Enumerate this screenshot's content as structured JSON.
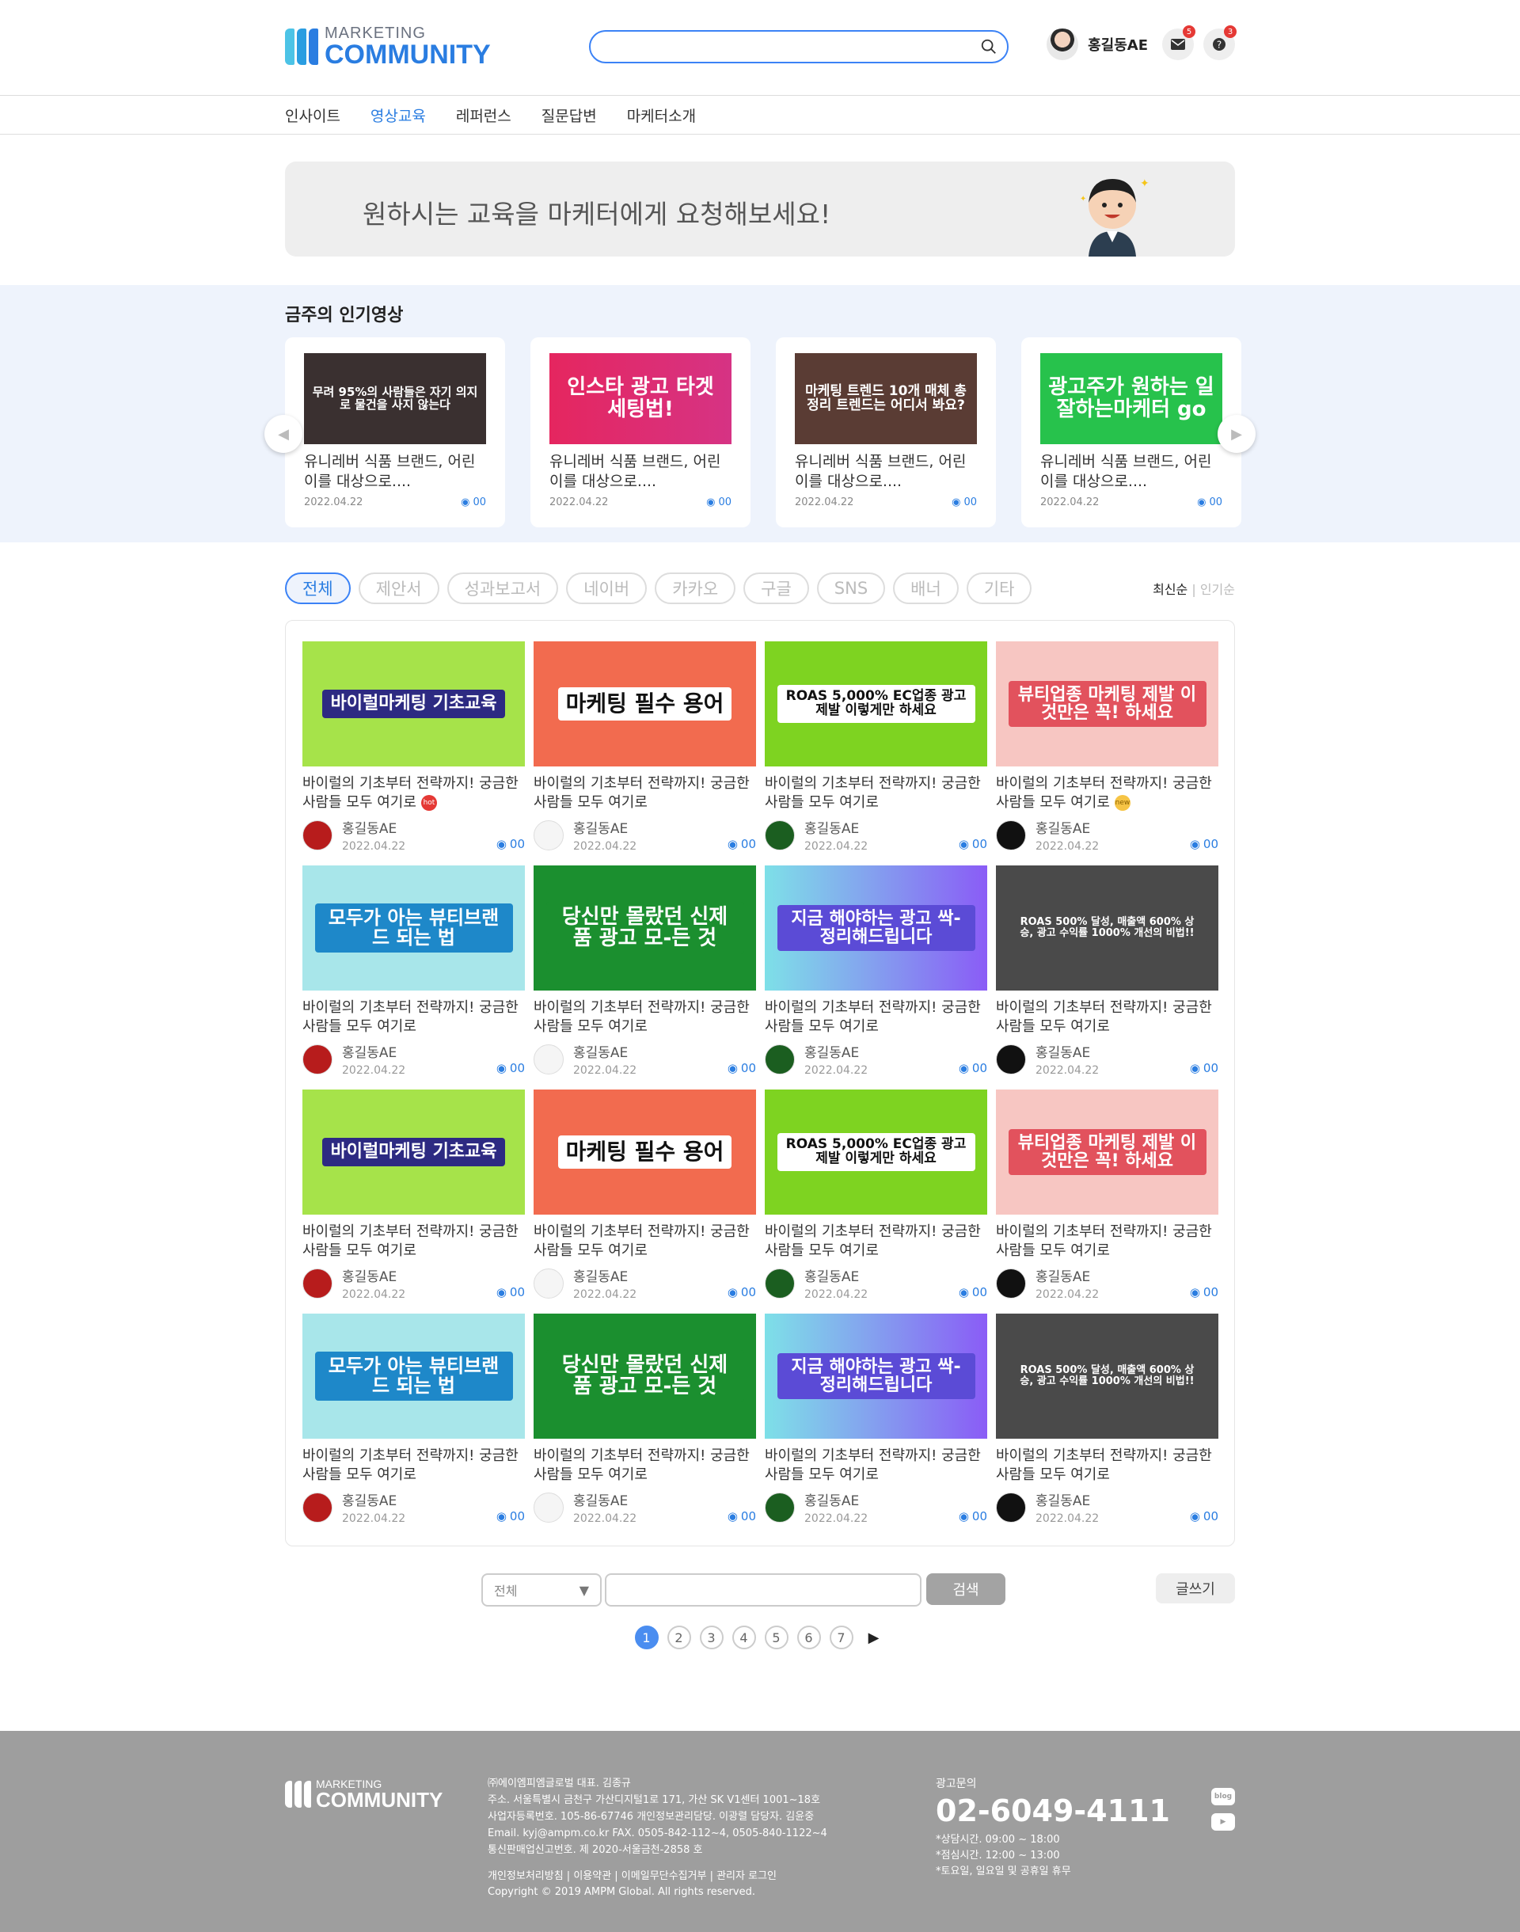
{
  "header": {
    "logo_top": "MARKETING",
    "logo_bottom": "COMMUNITY",
    "search_placeholder": "",
    "user_name": "홍길동AE",
    "mail_badge": "5",
    "question_badge": "3"
  },
  "nav": {
    "items": [
      "인사이트",
      "영상교육",
      "레퍼런스",
      "질문답변",
      "마케터소개"
    ],
    "active": "영상교육"
  },
  "banner": {
    "text": "원하시는 교육을 마케터에게 요청해보세요!"
  },
  "popular": {
    "title": "금주의 인기영상",
    "cards": [
      {
        "thumb": "무려 95%의 사람들은 자기 의지로 물건을 사지 않는다",
        "title": "유니레버 식품 브랜드, 어린이를 대상으로....",
        "date": "2022.04.22",
        "views": "00"
      },
      {
        "thumb": "인스타 광고 타겟 세팅법!",
        "title": "유니레버 식품 브랜드, 어린이를 대상으로....",
        "date": "2022.04.22",
        "views": "00"
      },
      {
        "thumb": "마케팅 트렌드 10개 매체 총정리 트렌드는 어디서 봐요?",
        "title": "유니레버 식품 브랜드, 어린이를 대상으로....",
        "date": "2022.04.22",
        "views": "00"
      },
      {
        "thumb": "광고주가 원하는 일잘하는마케터 go",
        "title": "유니레버 식품 브랜드, 어린이를 대상으로....",
        "date": "2022.04.22",
        "views": "00"
      }
    ]
  },
  "filters": {
    "chips": [
      "전체",
      "제안서",
      "성과보고서",
      "네이버",
      "카카오",
      "구글",
      "SNS",
      "배너",
      "기타"
    ],
    "active": "전체",
    "sort_latest": "최신순",
    "sort_popular": "인기순"
  },
  "videos": [
    {
      "thumb": "바이럴마케팅 기초교육",
      "title": "바이럴의 기초부터 전략까지! 궁금한 사람들 모두 여기로",
      "tag": "hot",
      "author": "홍길동AE",
      "date": "2022.04.22",
      "views": "00"
    },
    {
      "thumb": "마케팅 필수 용어",
      "title": "바이럴의 기초부터 전략까지! 궁금한 사람들 모두 여기로",
      "tag": "",
      "author": "홍길동AE",
      "date": "2022.04.22",
      "views": "00"
    },
    {
      "thumb": "ROAS 5,000% EC업종 광고 제발 이렇게만 하세요",
      "title": "바이럴의 기초부터 전략까지! 궁금한 사람들 모두 여기로",
      "tag": "",
      "author": "홍길동AE",
      "date": "2022.04.22",
      "views": "00"
    },
    {
      "thumb": "뷰티업종 마케팅 제발 이것만은 꼭! 하세요",
      "title": "바이럴의 기초부터 전략까지! 궁금한 사람들 모두 여기로",
      "tag": "new",
      "author": "홍길동AE",
      "date": "2022.04.22",
      "views": "00"
    },
    {
      "thumb": "모두가 아는 뷰티브랜드 되는 법",
      "title": "바이럴의 기초부터 전략까지! 궁금한 사람들 모두 여기로",
      "tag": "",
      "author": "홍길동AE",
      "date": "2022.04.22",
      "views": "00"
    },
    {
      "thumb": "당신만 몰랐던 신제품 광고 모-든 것",
      "title": "바이럴의 기초부터 전략까지! 궁금한 사람들 모두 여기로",
      "tag": "",
      "author": "홍길동AE",
      "date": "2022.04.22",
      "views": "00"
    },
    {
      "thumb": "지금 해야하는 광고 싹-정리해드립니다",
      "title": "바이럴의 기초부터 전략까지! 궁금한 사람들 모두 여기로",
      "tag": "",
      "author": "홍길동AE",
      "date": "2022.04.22",
      "views": "00"
    },
    {
      "thumb": "ROAS 500% 달성, 매출액 600% 상승, 광고 수익률 1000% 개선의 비법!!",
      "title": "바이럴의 기초부터 전략까지! 궁금한 사람들 모두 여기로",
      "tag": "",
      "author": "홍길동AE",
      "date": "2022.04.22",
      "views": "00"
    },
    {
      "thumb": "바이럴마케팅 기초교육",
      "title": "바이럴의 기초부터 전략까지! 궁금한 사람들 모두 여기로",
      "tag": "",
      "author": "홍길동AE",
      "date": "2022.04.22",
      "views": "00"
    },
    {
      "thumb": "마케팅 필수 용어",
      "title": "바이럴의 기초부터 전략까지! 궁금한 사람들 모두 여기로",
      "tag": "",
      "author": "홍길동AE",
      "date": "2022.04.22",
      "views": "00"
    },
    {
      "thumb": "ROAS 5,000% EC업종 광고 제발 이렇게만 하세요",
      "title": "바이럴의 기초부터 전략까지! 궁금한 사람들 모두 여기로",
      "tag": "",
      "author": "홍길동AE",
      "date": "2022.04.22",
      "views": "00"
    },
    {
      "thumb": "뷰티업종 마케팅 제발 이것만은 꼭! 하세요",
      "title": "바이럴의 기초부터 전략까지! 궁금한 사람들 모두 여기로",
      "tag": "",
      "author": "홍길동AE",
      "date": "2022.04.22",
      "views": "00"
    },
    {
      "thumb": "모두가 아는 뷰티브랜드 되는 법",
      "title": "바이럴의 기초부터 전략까지! 궁금한 사람들 모두 여기로",
      "tag": "",
      "author": "홍길동AE",
      "date": "2022.04.22",
      "views": "00"
    },
    {
      "thumb": "당신만 몰랐던 신제품 광고 모-든 것",
      "title": "바이럴의 기초부터 전략까지! 궁금한 사람들 모두 여기로",
      "tag": "",
      "author": "홍길동AE",
      "date": "2022.04.22",
      "views": "00"
    },
    {
      "thumb": "지금 해야하는 광고 싹-정리해드립니다",
      "title": "바이럴의 기초부터 전략까지! 궁금한 사람들 모두 여기로",
      "tag": "",
      "author": "홍길동AE",
      "date": "2022.04.22",
      "views": "00"
    },
    {
      "thumb": "ROAS 500% 달성, 매출액 600% 상승, 광고 수익률 1000% 개선의 비법!!",
      "title": "바이럴의 기초부터 전략까지! 궁금한 사람들 모두 여기로",
      "tag": "",
      "author": "홍길동AE",
      "date": "2022.04.22",
      "views": "00"
    }
  ],
  "search_bar": {
    "select_value": "전체",
    "button": "검색",
    "write_button": "글쓰기"
  },
  "pagination": {
    "pages": [
      "1",
      "2",
      "3",
      "4",
      "5",
      "6",
      "7"
    ],
    "current": "1"
  },
  "footer": {
    "info": [
      "㈜에이엠피엠글로벌  대표. 김종규",
      "주소. 서울특별시 금천구 가산디지털1로 171, 가산 SK V1센터 1001~18호",
      "사업자등록번호. 105-86-67746  개인정보관리담당. 이광렬  담당자. 김윤중",
      "Email. kyj@ampm.co.kr  FAX. 0505-842-112~4, 0505-840-1122~4",
      "통신판매업신고번호. 제 2020-서울금천-2858 호"
    ],
    "links": "개인정보처리방침  |  이용약관  |  이메일무단수집거부  |  관리자 로그인",
    "copyright": "Copyright © 2019 AMPM Global. All rights reserved.",
    "contact_label": "광고문의",
    "phone": "02-6049-4111",
    "hours": [
      "*상담시간. 09:00 ~ 18:00",
      "*점심시간. 12:00 ~ 13:00",
      "*토요일, 일요일 및 공휴일 휴무"
    ],
    "social": [
      "blog",
      "youtube"
    ]
  }
}
